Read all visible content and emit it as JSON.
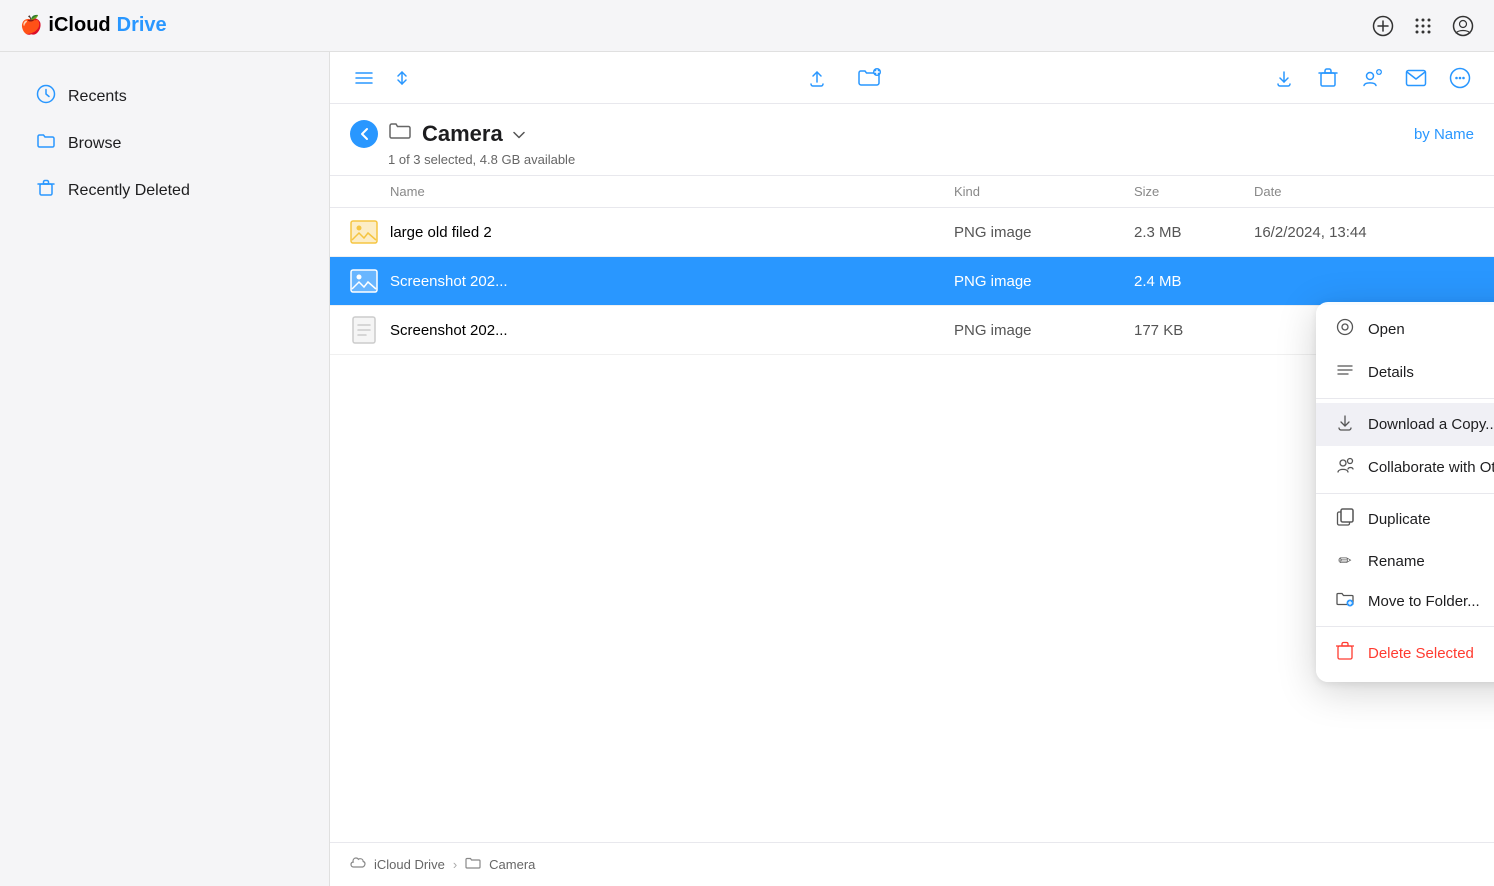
{
  "app": {
    "title_icloud": "iCloud",
    "title_drive": "Drive",
    "apple_icon": "🍎"
  },
  "titlebar": {
    "icons": {
      "add": "⊕",
      "grid": "⣿",
      "profile": "👤"
    }
  },
  "sidebar": {
    "items": [
      {
        "id": "recents",
        "label": "Recents",
        "icon": "🕐"
      },
      {
        "id": "browse",
        "label": "Browse",
        "icon": "📁"
      },
      {
        "id": "recently-deleted",
        "label": "Recently Deleted",
        "icon": "🗑"
      }
    ]
  },
  "toolbar": {
    "list_icon": "☰",
    "sort_icon": "⇅",
    "upload_icon": "↑",
    "new_folder_icon": "📁+",
    "download_icon": "↓",
    "delete_icon": "🗑",
    "share_icon": "👤+",
    "email_icon": "✉",
    "more_icon": "…"
  },
  "folder": {
    "name": "Camera",
    "icon": "📁",
    "back_label": "‹",
    "chevron": "˅",
    "sort_label": "by Name",
    "subtitle": "1 of 3 selected, 4.8 GB available"
  },
  "columns": {
    "name": "Name",
    "kind": "Kind",
    "size": "Size",
    "date": "Date"
  },
  "files": [
    {
      "id": "file1",
      "icon": "🖼",
      "icon_color": "#f5c542",
      "name": "large old filed 2",
      "kind": "PNG image",
      "size": "2.3 MB",
      "date": "16/2/2024, 13:44",
      "selected": false
    },
    {
      "id": "file2",
      "icon": "🖼",
      "icon_color": "#2997ff",
      "name": "Screenshot 202...",
      "kind": "PNG image",
      "size": "2.4 MB",
      "date": "",
      "selected": true
    },
    {
      "id": "file3",
      "icon": "📄",
      "icon_color": "#ccc",
      "name": "Screenshot 202...",
      "kind": "PNG image",
      "size": "177 KB",
      "date": "",
      "selected": false
    }
  ],
  "context_menu": {
    "items": [
      {
        "id": "open",
        "label": "Open",
        "icon": "⊙",
        "divider_after": false
      },
      {
        "id": "details",
        "label": "Details",
        "icon": "≡",
        "divider_after": true
      },
      {
        "id": "download",
        "label": "Download a Copy...",
        "icon": "↓",
        "divider_after": false,
        "highlighted": true
      },
      {
        "id": "collaborate",
        "label": "Collaborate with Others...",
        "icon": "👥",
        "divider_after": true
      },
      {
        "id": "duplicate",
        "label": "Duplicate",
        "icon": "📋",
        "divider_after": false
      },
      {
        "id": "rename",
        "label": "Rename",
        "icon": "✏",
        "divider_after": false
      },
      {
        "id": "move",
        "label": "Move to Folder...",
        "icon": "📂",
        "divider_after": true
      },
      {
        "id": "delete",
        "label": "Delete Selected",
        "icon": "🗑",
        "divider_after": false,
        "danger": true
      }
    ]
  },
  "breadcrumb": {
    "parts": [
      "iCloud Drive",
      "Camera"
    ],
    "separator": "›"
  }
}
